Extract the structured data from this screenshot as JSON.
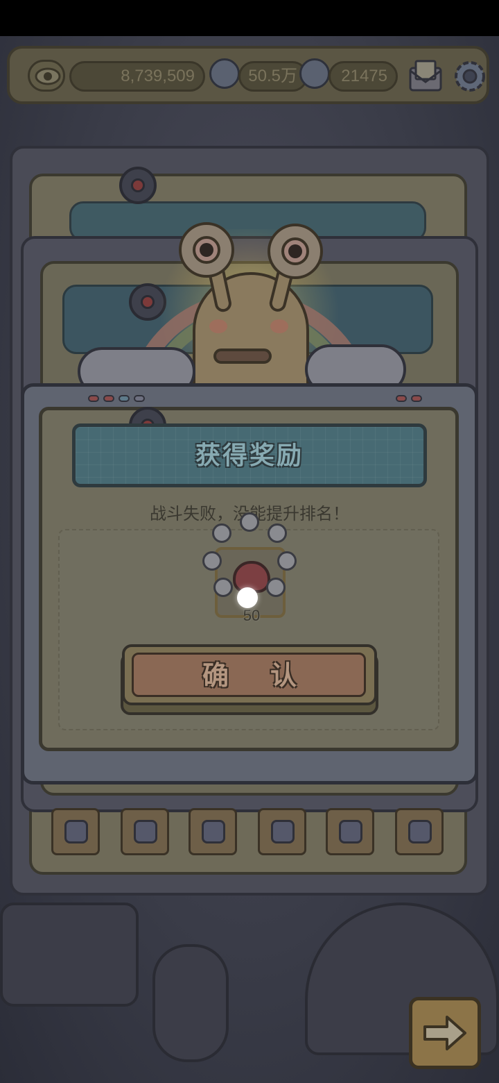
{
  "topbar": {
    "eye_icon": "eye-icon",
    "currency1_value": "8,739,509",
    "currency2_value": "50.5万",
    "currency3_value": "21475",
    "mail_icon": "mail-icon",
    "settings_icon": "gear-icon"
  },
  "dialog": {
    "title": "获得奖励",
    "message": "战斗失败，没能提升排名！",
    "reward": {
      "icon": "boxing-glove-icon",
      "count": "50"
    },
    "confirm_label": "确认"
  },
  "equipment": [
    "hoverboard-icon",
    "rocket-icon",
    "dress-icon",
    "wand-icon",
    "ring-icon",
    "belt-icon"
  ],
  "next_icon": "arrow-right-icon",
  "colors": {
    "overlay": "#2c2e3a",
    "title_plate": "#476a73",
    "confirm_button": "#8a6854"
  }
}
